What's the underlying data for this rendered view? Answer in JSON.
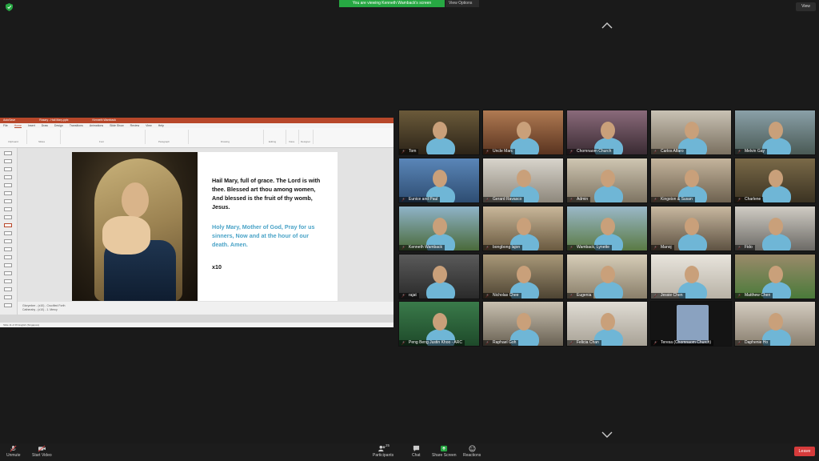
{
  "banner": {
    "text": "You are viewing Kenneth Wamback's screen",
    "view_options": "View Options"
  },
  "view_button": "View",
  "powerpoint": {
    "title_left": "AutoSave",
    "title_mid": "Rosary - Hail Mary.pptx",
    "title_right": "Kenneth Wamback",
    "tabs": [
      "File",
      "Home",
      "Insert",
      "Draw",
      "Design",
      "Transitions",
      "Animations",
      "Slide Show",
      "Review",
      "View",
      "Help"
    ],
    "ribbon_groups": [
      "Clipboard",
      "Slides",
      "Font",
      "Paragraph",
      "Drawing",
      "Editing",
      "Voice",
      "Designer"
    ],
    "slide": {
      "verse1": "Hail Mary, full of grace. The Lord is with thee. Blessed art thou among women, And blessed is the fruit of thy womb, Jesus.",
      "verse2": "Holy Mary, Mother of God, Pray for us sinners, Now and at the hour of our death. Amen.",
      "times": "x10"
    },
    "notes": [
      "Glorymber - (x10) - Crucified Forth",
      "Catherahy - (x10) - 1. Mercy"
    ],
    "status": "Slide 11 of 45    English (Singapore)"
  },
  "participants": [
    {
      "name": "Tom"
    },
    {
      "name": "Uncle Marc"
    },
    {
      "name": "Chomnaom Church"
    },
    {
      "name": "Carlos Alfaro"
    },
    {
      "name": "Melvin Gay"
    },
    {
      "name": "Eunice and Paul"
    },
    {
      "name": "Gerard Ravasco"
    },
    {
      "name": "Admin"
    },
    {
      "name": "Kingston & Susan"
    },
    {
      "name": "Charlene"
    },
    {
      "name": "Kenneth Wamback"
    },
    {
      "name": "bongbong lajon"
    },
    {
      "name": "Wamback, Lynette"
    },
    {
      "name": "Manoj"
    },
    {
      "name": "Fido"
    },
    {
      "name": "rajat"
    },
    {
      "name": "Nicholas Chee"
    },
    {
      "name": "Eugenia"
    },
    {
      "name": "Jessie Chen"
    },
    {
      "name": "Matthew Chen"
    },
    {
      "name": "Peng Beng Justin Khoo - ARC"
    },
    {
      "name": "Raphael Goh"
    },
    {
      "name": "Felicia Chan"
    },
    {
      "name": "Teresa (Chomnaom Church)"
    },
    {
      "name": "Daphenie Ho"
    }
  ],
  "toolbar": {
    "unmute": "Unmute",
    "start_video": "Start Video",
    "participants": "Participants",
    "participant_count": "25",
    "chat": "Chat",
    "share_screen": "Share Screen",
    "reactions": "Reactions",
    "leave": "Leave"
  },
  "colors": {
    "banner": "#27a843",
    "leave": "#d63b3b",
    "share": "#27a843",
    "ppt_accent": "#b7472a",
    "verse2": "#4aa3c7"
  }
}
